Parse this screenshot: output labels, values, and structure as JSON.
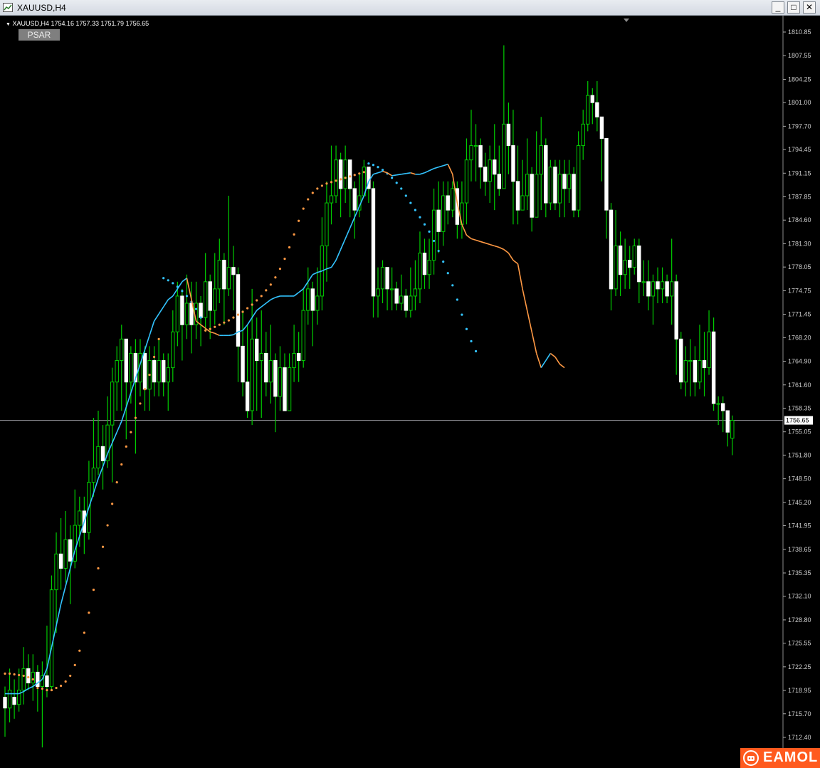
{
  "window": {
    "title": "XAUUSD,H4",
    "buttons": {
      "minimize": "_",
      "maximize": "□",
      "close": "✕"
    }
  },
  "chart": {
    "symbol_info": "XAUUSD,H4  1754.16 1757.33 1751.79 1756.65",
    "indicator_button": "PSAR",
    "current_price_label": "1756.65",
    "colors": {
      "background": "#000000",
      "bull_candle": "#00cc00",
      "bear_candle": "#ffffff",
      "ma_up": "#33c4ff",
      "ma_down": "#ff9944",
      "psar_up": "#33c4ff",
      "psar_down": "#ff9944",
      "axis_text": "#cccccc",
      "price_line": "#9a9aa0"
    }
  },
  "chart_data": {
    "type": "candlestick",
    "title": "XAUUSD,H4",
    "y_ticks": [
      "1810.85",
      "1807.55",
      "1804.25",
      "1801.00",
      "1797.70",
      "1794.45",
      "1791.15",
      "1787.85",
      "1784.60",
      "1781.30",
      "1778.05",
      "1774.75",
      "1771.45",
      "1768.20",
      "1764.90",
      "1761.60",
      "1758.35",
      "1755.05",
      "1751.80",
      "1748.50",
      "1745.20",
      "1741.95",
      "1738.65",
      "1735.35",
      "1732.10",
      "1728.80",
      "1725.55",
      "1722.25",
      "1718.95",
      "1715.70",
      "1712.40"
    ],
    "ylim": [
      1710.4,
      1812.4
    ],
    "current_price": 1756.65,
    "candles": [
      [
        1718,
        1716.5,
        1719.5,
        1712.5
      ],
      [
        1716.5,
        1719,
        1722,
        1714.5
      ],
      [
        1718,
        1717,
        1720.5,
        1715
      ],
      [
        1717,
        1719,
        1722,
        1716
      ],
      [
        1719,
        1722,
        1725,
        1717
      ],
      [
        1722,
        1720,
        1724,
        1719
      ],
      [
        1720,
        1721.5,
        1724,
        1717.5
      ],
      [
        1721.5,
        1719.5,
        1722.5,
        1716
      ],
      [
        1719.5,
        1721,
        1723,
        1711
      ],
      [
        1721,
        1719.5,
        1728,
        1718
      ],
      [
        1719.5,
        1733,
        1735,
        1719
      ],
      [
        1733,
        1738,
        1741,
        1727
      ],
      [
        1738,
        1736,
        1743,
        1733
      ],
      [
        1736,
        1740,
        1744,
        1734
      ],
      [
        1740,
        1737,
        1742,
        1731
      ],
      [
        1737,
        1742,
        1747,
        1736
      ],
      [
        1742,
        1744,
        1746,
        1739
      ],
      [
        1744,
        1741,
        1746,
        1738
      ],
      [
        1741,
        1748,
        1751,
        1740
      ],
      [
        1748,
        1750,
        1757,
        1746
      ],
      [
        1750,
        1753,
        1758,
        1749
      ],
      [
        1753,
        1751,
        1756,
        1747
      ],
      [
        1751,
        1756,
        1760,
        1750
      ],
      [
        1756,
        1762,
        1764,
        1748
      ],
      [
        1762,
        1765,
        1767,
        1758
      ],
      [
        1765,
        1768,
        1770,
        1758
      ],
      [
        1768,
        1762,
        1768,
        1754
      ],
      [
        1762,
        1766,
        1767,
        1759
      ],
      [
        1766,
        1762,
        1768,
        1752
      ],
      [
        1762,
        1766,
        1768,
        1760
      ],
      [
        1766,
        1761,
        1767,
        1758
      ],
      [
        1761,
        1765,
        1767,
        1758
      ],
      [
        1765,
        1762,
        1767,
        1760
      ],
      [
        1762,
        1765,
        1768,
        1760
      ],
      [
        1765,
        1762,
        1766,
        1760
      ],
      [
        1762,
        1764,
        1766,
        1758
      ],
      [
        1764,
        1769,
        1772,
        1762
      ],
      [
        1769,
        1774,
        1776,
        1767
      ],
      [
        1774,
        1770,
        1775,
        1765
      ],
      [
        1770,
        1773,
        1777,
        1768
      ],
      [
        1773,
        1770,
        1776,
        1766
      ],
      [
        1770,
        1773,
        1776,
        1768
      ],
      [
        1773,
        1771,
        1774,
        1767
      ],
      [
        1771,
        1776,
        1780,
        1769
      ],
      [
        1776,
        1772,
        1777,
        1768
      ],
      [
        1772,
        1775,
        1780,
        1770
      ],
      [
        1775,
        1779,
        1782,
        1773
      ],
      [
        1779,
        1775,
        1780,
        1770
      ],
      [
        1775,
        1778,
        1788,
        1774
      ],
      [
        1778,
        1777,
        1781,
        1772
      ],
      [
        1777,
        1767,
        1778,
        1762
      ],
      [
        1767,
        1762,
        1772,
        1760
      ],
      [
        1762,
        1758,
        1770,
        1757
      ],
      [
        1758,
        1768,
        1775,
        1756
      ],
      [
        1768,
        1765,
        1771,
        1758
      ],
      [
        1765,
        1766,
        1772,
        1757
      ],
      [
        1766,
        1762,
        1769,
        1760
      ],
      [
        1762,
        1765,
        1770,
        1759
      ],
      [
        1765,
        1760,
        1766,
        1755
      ],
      [
        1760,
        1764,
        1767,
        1758
      ],
      [
        1764,
        1758,
        1766,
        1758
      ],
      [
        1758,
        1764,
        1766,
        1760
      ],
      [
        1764,
        1766,
        1770,
        1762
      ],
      [
        1766,
        1765,
        1769,
        1762
      ],
      [
        1765,
        1772,
        1775,
        1764
      ],
      [
        1772,
        1775,
        1778,
        1770
      ],
      [
        1775,
        1772,
        1776,
        1767
      ],
      [
        1772,
        1774,
        1778,
        1770
      ],
      [
        1774,
        1781,
        1785,
        1772
      ],
      [
        1781,
        1787,
        1790,
        1776
      ],
      [
        1787,
        1788,
        1795,
        1784
      ],
      [
        1788,
        1793,
        1795,
        1787
      ],
      [
        1793,
        1789,
        1794,
        1785
      ],
      [
        1789,
        1793,
        1795,
        1787
      ],
      [
        1793,
        1789,
        1791,
        1785
      ],
      [
        1789,
        1786,
        1790,
        1782
      ],
      [
        1786,
        1788,
        1791,
        1785
      ],
      [
        1788,
        1792,
        1793,
        1788
      ],
      [
        1792,
        1789,
        1791,
        1787
      ],
      [
        1789,
        1774,
        1790,
        1771
      ],
      [
        1774,
        1775,
        1778,
        1771
      ],
      [
        1775,
        1778,
        1779,
        1773
      ],
      [
        1778,
        1775,
        1778,
        1772
      ],
      [
        1775,
        1775,
        1778,
        1772
      ],
      [
        1775,
        1773,
        1776,
        1772
      ],
      [
        1773,
        1774,
        1777,
        1772
      ],
      [
        1774,
        1772,
        1775,
        1771
      ],
      [
        1772,
        1774,
        1778,
        1771
      ],
      [
        1774,
        1775,
        1779,
        1772
      ],
      [
        1775,
        1780,
        1783,
        1773
      ],
      [
        1780,
        1777,
        1782,
        1775
      ],
      [
        1777,
        1779,
        1782,
        1775
      ],
      [
        1779,
        1786,
        1789,
        1777
      ],
      [
        1786,
        1783,
        1790,
        1780
      ],
      [
        1783,
        1788,
        1790,
        1781
      ],
      [
        1788,
        1786,
        1790,
        1784
      ],
      [
        1786,
        1789,
        1790,
        1785
      ],
      [
        1789,
        1784,
        1790,
        1782
      ],
      [
        1784,
        1787,
        1790,
        1782
      ],
      [
        1787,
        1793,
        1796,
        1784
      ],
      [
        1793,
        1795,
        1800,
        1790
      ],
      [
        1795,
        1795,
        1798,
        1790
      ],
      [
        1795,
        1792,
        1796,
        1789
      ],
      [
        1792,
        1790,
        1794,
        1788
      ],
      [
        1790,
        1793,
        1795,
        1787
      ],
      [
        1793,
        1791,
        1798,
        1786
      ],
      [
        1791,
        1789,
        1795,
        1788
      ],
      [
        1789,
        1798,
        1809,
        1789
      ],
      [
        1798,
        1795,
        1801,
        1791
      ],
      [
        1795,
        1790,
        1800,
        1784
      ],
      [
        1790,
        1786,
        1795,
        1784
      ],
      [
        1786,
        1788,
        1793,
        1787
      ],
      [
        1788,
        1791,
        1796,
        1786
      ],
      [
        1791,
        1785,
        1792,
        1783
      ],
      [
        1785,
        1791,
        1797,
        1785
      ],
      [
        1791,
        1795,
        1799,
        1786
      ],
      [
        1795,
        1787,
        1796,
        1785
      ],
      [
        1787,
        1792,
        1793,
        1786
      ],
      [
        1792,
        1787,
        1793,
        1786
      ],
      [
        1787,
        1791,
        1793,
        1785
      ],
      [
        1791,
        1789,
        1793,
        1785
      ],
      [
        1789,
        1791,
        1793,
        1787
      ],
      [
        1791,
        1786,
        1792,
        1785
      ],
      [
        1786,
        1795,
        1797,
        1785
      ],
      [
        1795,
        1798,
        1800,
        1793
      ],
      [
        1798,
        1802,
        1804,
        1797
      ],
      [
        1802,
        1801,
        1803,
        1798
      ],
      [
        1801,
        1799,
        1804,
        1797
      ],
      [
        1799,
        1796,
        1799,
        1790
      ],
      [
        1796,
        1786,
        1796,
        1782
      ],
      [
        1786,
        1775,
        1787,
        1772
      ],
      [
        1775,
        1781,
        1786,
        1774
      ],
      [
        1781,
        1777,
        1783,
        1774
      ],
      [
        1777,
        1779,
        1782,
        1775
      ],
      [
        1779,
        1778,
        1781,
        1775
      ],
      [
        1778,
        1781,
        1782,
        1777
      ],
      [
        1781,
        1776,
        1782,
        1773
      ],
      [
        1776,
        1776,
        1779,
        1774
      ],
      [
        1776,
        1774,
        1779,
        1772
      ],
      [
        1774,
        1776,
        1777,
        1770
      ],
      [
        1776,
        1775,
        1778,
        1773
      ],
      [
        1775,
        1776,
        1778,
        1773
      ],
      [
        1776,
        1774,
        1777,
        1773
      ],
      [
        1774,
        1776,
        1782,
        1770
      ],
      [
        1776,
        1768,
        1777,
        1763
      ],
      [
        1768,
        1762,
        1769,
        1761
      ],
      [
        1762,
        1765,
        1767,
        1760
      ],
      [
        1765,
        1765,
        1768,
        1760
      ],
      [
        1765,
        1762,
        1767,
        1760
      ],
      [
        1762,
        1765,
        1770,
        1761
      ],
      [
        1765,
        1764,
        1769,
        1760
      ],
      [
        1764,
        1769,
        1772,
        1763
      ],
      [
        1769,
        1759,
        1771,
        1758
      ],
      [
        1759,
        1759,
        1760,
        1756
      ],
      [
        1759,
        1758,
        1760,
        1755
      ],
      [
        1758,
        1755,
        1758,
        1753
      ],
      [
        1754.16,
        1756.65,
        1757.33,
        1751.79
      ]
    ],
    "moving_average": [
      1718.5,
      1718.5,
      1718.5,
      1718.5,
      1718.8,
      1719.2,
      1719.5,
      1720,
      1720.5,
      1722,
      1725,
      1728,
      1731,
      1733.5,
      1736,
      1738.5,
      1740.5,
      1742.5,
      1744.5,
      1746.5,
      1748.5,
      1750.2,
      1752,
      1753.5,
      1755,
      1756.5,
      1758.5,
      1760.5,
      1762.5,
      1764.5,
      1766.5,
      1768.5,
      1770.5,
      1771.5,
      1772.5,
      1773.5,
      1774,
      1775,
      1776,
      1776.5,
      1773.5,
      1770.5,
      1770,
      1769.5,
      1769,
      1768.8,
      1768.5,
      1768.5,
      1768.5,
      1768.6,
      1769,
      1769.2,
      1770,
      1771,
      1772,
      1772.5,
      1773,
      1773.5,
      1773.8,
      1774,
      1774,
      1774,
      1774,
      1774.5,
      1775,
      1776,
      1777,
      1777.3,
      1777.5,
      1777.8,
      1778,
      1779,
      1780.5,
      1782,
      1783.5,
      1785,
      1786.5,
      1788,
      1790,
      1791,
      1791.2,
      1791.4,
      1791.2,
      1790.8,
      1790.9,
      1791,
      1791.1,
      1791.2,
      1791,
      1791,
      1791.2,
      1791.5,
      1791.8,
      1792,
      1792.2,
      1792.4,
      1791,
      1787,
      1784,
      1782.5,
      1782,
      1781.8,
      1781.6,
      1781.4,
      1781.2,
      1781,
      1780.8,
      1780.5,
      1780,
      1779,
      1778.5,
      1775,
      1772,
      1769,
      1766,
      1764,
      1765,
      1766,
      1765.5,
      1764.5,
      1764
    ],
    "psar": [
      [
        0,
        1721.3
      ],
      [
        1,
        1721.3
      ],
      [
        2,
        1721.2
      ],
      [
        3,
        1721.1
      ],
      [
        4,
        1721
      ],
      [
        5,
        1720.8
      ],
      [
        6,
        1720.5
      ],
      [
        7,
        1719.3
      ],
      [
        8,
        1719.2
      ],
      [
        9,
        1719
      ],
      [
        10,
        1719
      ],
      [
        11,
        1719.3
      ],
      [
        12,
        1719.6
      ],
      [
        13,
        1720.2
      ],
      [
        14,
        1721
      ],
      [
        15,
        1722.5
      ],
      [
        16,
        1724.5
      ],
      [
        17,
        1727
      ],
      [
        18,
        1729.8
      ],
      [
        19,
        1733
      ],
      [
        20,
        1736
      ],
      [
        21,
        1739
      ],
      [
        22,
        1742
      ],
      [
        23,
        1745
      ],
      [
        24,
        1748
      ],
      [
        25,
        1750.5
      ],
      [
        26,
        1753
      ],
      [
        27,
        1755
      ],
      [
        28,
        1757
      ],
      [
        29,
        1759
      ],
      [
        30,
        1761
      ],
      [
        31,
        1763
      ],
      [
        32,
        1765.5
      ],
      [
        33,
        1768
      ],
      [
        34,
        1776.5
      ],
      [
        35,
        1776.2
      ],
      [
        36,
        1775.8
      ],
      [
        37,
        1775.3
      ],
      [
        38,
        1774.7
      ],
      [
        39,
        1774
      ],
      [
        40,
        1773.2
      ],
      [
        41,
        1772.2
      ],
      [
        42,
        1771
      ],
      [
        43,
        1769.2
      ],
      [
        44,
        1769.4
      ],
      [
        45,
        1769.7
      ],
      [
        46,
        1770
      ],
      [
        47,
        1770.3
      ],
      [
        48,
        1770.6
      ],
      [
        49,
        1771
      ],
      [
        50,
        1771.4
      ],
      [
        51,
        1771.8
      ],
      [
        52,
        1772.3
      ],
      [
        53,
        1772.8
      ],
      [
        54,
        1773.4
      ],
      [
        55,
        1774
      ],
      [
        56,
        1774.8
      ],
      [
        57,
        1775.6
      ],
      [
        58,
        1776.6
      ],
      [
        59,
        1777.8
      ],
      [
        60,
        1779.2
      ],
      [
        61,
        1780.8
      ],
      [
        62,
        1782.6
      ],
      [
        63,
        1784.5
      ],
      [
        64,
        1786.2
      ],
      [
        65,
        1787.5
      ],
      [
        66,
        1788.4
      ],
      [
        67,
        1789
      ],
      [
        68,
        1789.4
      ],
      [
        69,
        1789.7
      ],
      [
        70,
        1789.9
      ],
      [
        71,
        1790.1
      ],
      [
        72,
        1790.3
      ],
      [
        73,
        1790.5
      ],
      [
        74,
        1790.7
      ],
      [
        75,
        1790.9
      ],
      [
        76,
        1791.1
      ],
      [
        77,
        1791.3
      ],
      [
        78,
        1792.5
      ],
      [
        79,
        1792.3
      ],
      [
        80,
        1792
      ],
      [
        81,
        1791.6
      ],
      [
        82,
        1791.1
      ],
      [
        83,
        1790.5
      ],
      [
        84,
        1789.8
      ],
      [
        85,
        1789
      ],
      [
        86,
        1788
      ],
      [
        87,
        1787
      ],
      [
        88,
        1786
      ],
      [
        89,
        1785
      ],
      [
        90,
        1784
      ],
      [
        91,
        1783
      ],
      [
        92,
        1781.7
      ],
      [
        93,
        1780.3
      ],
      [
        94,
        1778.8
      ],
      [
        95,
        1777.2
      ],
      [
        96,
        1775.5
      ],
      [
        97,
        1773.5
      ],
      [
        98,
        1771.4
      ],
      [
        99,
        1769.4
      ],
      [
        100,
        1767.7
      ],
      [
        101,
        1766.3
      ]
    ],
    "psar_trend_breaks": [
      33,
      42,
      77
    ]
  }
}
